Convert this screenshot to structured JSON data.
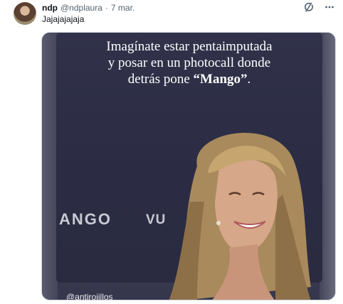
{
  "tweet": {
    "author_name": "ndp",
    "author_handle": "@ndplaura",
    "separator": "·",
    "time": "7 mar.",
    "text": "Jajajajajaja",
    "icons": {
      "grok": "grok-icon",
      "more": "more-icon"
    }
  },
  "media": {
    "caption_line1": "Imagínate estar pentaimputada",
    "caption_line2": "y posar en un photocall donde",
    "caption_line3_prefix": "detrás pone ",
    "caption_line3_bold": "“Mango”",
    "caption_line3_suffix": ".",
    "brand_text": "ANGO",
    "brand_text_2": "VU",
    "watermark": "@antirojillos"
  },
  "colors": {
    "name": "#0f1419",
    "secondary": "#536471",
    "photo_background": "#2b2c44"
  }
}
